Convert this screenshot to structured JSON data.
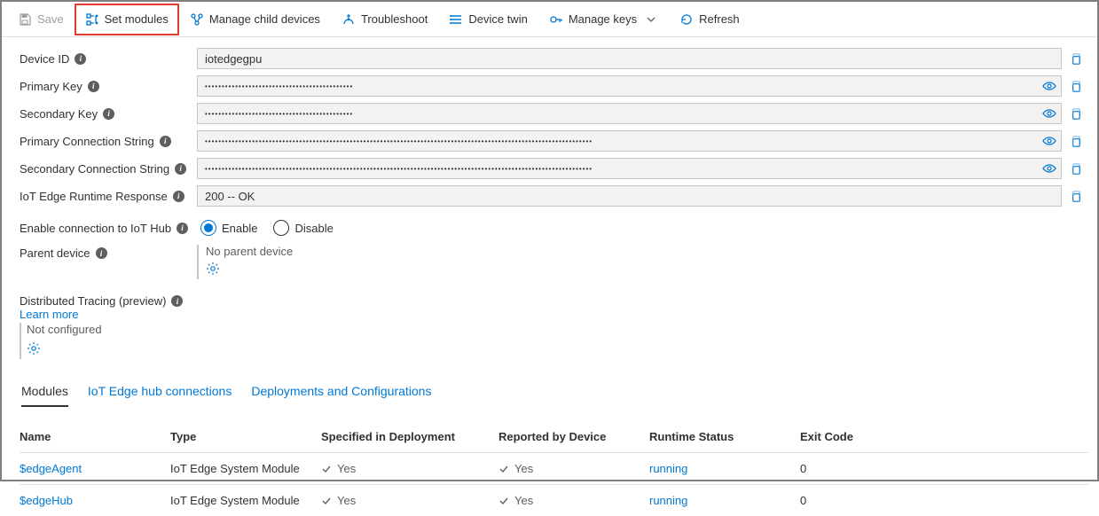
{
  "toolbar": {
    "save": "Save",
    "set_modules": "Set modules",
    "manage_child": "Manage child devices",
    "troubleshoot": "Troubleshoot",
    "device_twin": "Device twin",
    "manage_keys": "Manage keys",
    "refresh": "Refresh"
  },
  "fields": {
    "device_id": {
      "label": "Device ID",
      "value": "iotedgegpu"
    },
    "primary_key": {
      "label": "Primary Key",
      "value": "••••••••••••••••••••••••••••••••••••••••••••"
    },
    "secondary_key": {
      "label": "Secondary Key",
      "value": "••••••••••••••••••••••••••••••••••••••••••••"
    },
    "primary_conn": {
      "label": "Primary Connection String",
      "value": "•••••••••••••••••••••••••••••••••••••••••••••••••••••••••••••••••••••••••••••••••••••••••••••••••••••••••••••••••••"
    },
    "secondary_conn": {
      "label": "Secondary Connection String",
      "value": "•••••••••••••••••••••••••••••••••••••••••••••••••••••••••••••••••••••••••••••••••••••••••••••••••••••••••••••••••••"
    },
    "runtime_resp": {
      "label": "IoT Edge Runtime Response",
      "value": "200 -- OK"
    },
    "enable_conn": {
      "label": "Enable connection to IoT Hub",
      "enable": "Enable",
      "disable": "Disable"
    },
    "parent": {
      "label": "Parent device",
      "none": "No parent device"
    },
    "tracing": {
      "label": "Distributed Tracing (preview)",
      "learn": "Learn more",
      "not_conf": "Not configured"
    }
  },
  "tabs": {
    "modules": "Modules",
    "hub_conn": "IoT Edge hub connections",
    "deployments": "Deployments and Configurations"
  },
  "table": {
    "headers": {
      "name": "Name",
      "type": "Type",
      "spec": "Specified in Deployment",
      "rep": "Reported by Device",
      "run": "Runtime Status",
      "exit": "Exit Code"
    },
    "yes": "Yes",
    "rows": [
      {
        "name": "$edgeAgent",
        "type": "IoT Edge System Module",
        "spec": true,
        "rep": true,
        "run": "running",
        "exit": "0"
      },
      {
        "name": "$edgeHub",
        "type": "IoT Edge System Module",
        "spec": true,
        "rep": true,
        "run": "running",
        "exit": "0"
      }
    ]
  }
}
